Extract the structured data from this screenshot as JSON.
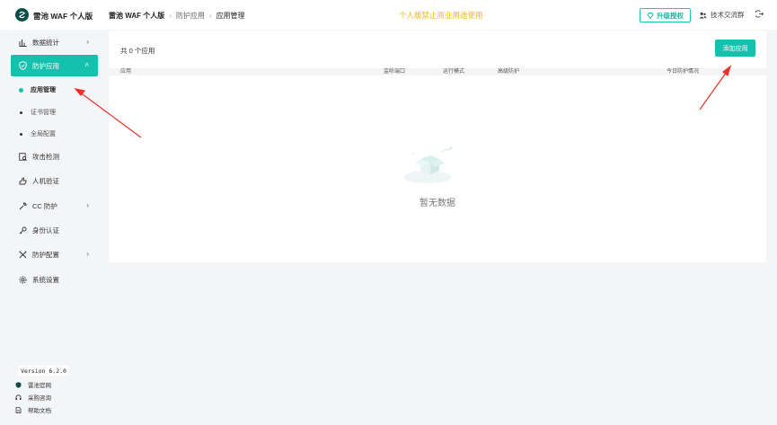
{
  "header": {
    "logo_text": "雷池 WAF 个人版",
    "breadcrumb": [
      "雷池 WAF 个人版",
      "防护应用",
      "应用管理"
    ],
    "notice": "个人版禁止商业用途使用",
    "upgrade_label": "升级授权",
    "group_label": "技术交流群"
  },
  "sidebar": {
    "items": [
      {
        "label": "数据统计",
        "icon": "bar-chart-icon",
        "chevron": "›"
      },
      {
        "label": "防护应用",
        "icon": "shield-icon",
        "chevron": "˄"
      },
      {
        "label": "攻击检测",
        "icon": "detect-icon"
      },
      {
        "label": "人机验证",
        "icon": "hand-icon"
      },
      {
        "label": "CC 防护",
        "icon": "wrench-icon",
        "chevron": "›"
      },
      {
        "label": "身份认证",
        "icon": "key-icon"
      },
      {
        "label": "防护配置",
        "icon": "tools-icon",
        "chevron": "›"
      },
      {
        "label": "系统设置",
        "icon": "gear-icon"
      }
    ],
    "sub_items": [
      {
        "label": "应用管理"
      },
      {
        "label": "证书管理"
      },
      {
        "label": "全局配置"
      }
    ],
    "version": "Version 6.2.0",
    "footer_links": [
      {
        "label": "雷池官网",
        "icon": "shield-small-icon"
      },
      {
        "label": "采购咨询",
        "icon": "headset-icon"
      },
      {
        "label": "帮助文档",
        "icon": "doc-icon"
      }
    ]
  },
  "main": {
    "count_text": "共 0 个应用",
    "add_label": "添加应用",
    "columns": [
      "应用",
      "监听端口",
      "运行模式",
      "高级防护",
      "今日防护情况"
    ],
    "empty_text": "暂无数据"
  },
  "colors": {
    "accent": "#14c1ad",
    "notice": "#f5b400",
    "annotation_arrow": "#e8322b"
  }
}
